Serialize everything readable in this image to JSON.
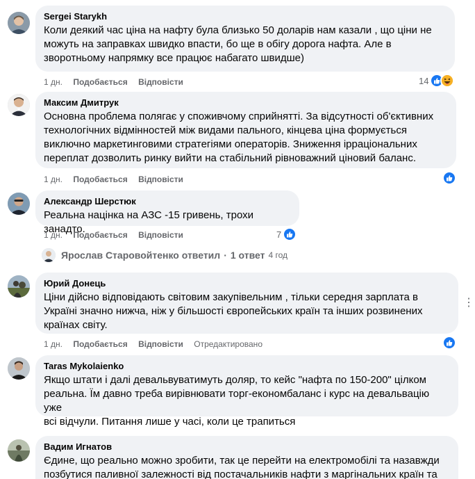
{
  "comments": [
    {
      "author": "Sergei Starykh",
      "lines": [
        "Коли деякий час ціна на нафту була близько 50 доларів нам казали , що ціни не",
        "можуть на заправках швидко впасти, бо ще в обігу дорога нафта. Але в",
        "зворотньому напрямку все працює набагато швидше)"
      ],
      "time": "1 дн.",
      "like": "Подобається",
      "reply": "Відповісти",
      "reaction_count": "14"
    },
    {
      "author": "Максим Дмитрук",
      "lines": [
        "Основна проблема полягає у споживчому сприйнятті. За відсутності об'єктивних",
        "технологічних відмінностей між видами пального, кінцева ціна формується",
        "виключно маркетинговими стратегіями операторів. Зниження ірраціональних",
        "переплат дозволить ринку вийти на стабільний рівноважний ціновий баланс."
      ],
      "time": "1 дн.",
      "like": "Подобається",
      "reply": "Відповісти",
      "reaction_count": ""
    },
    {
      "author": "Александр Шерстюк",
      "lines": [
        "Реальна націнка на АЗС -15 гривень, трохи занадто."
      ],
      "time": "1 дн.",
      "like": "Подобається",
      "reply": "Відповісти",
      "reaction_count": "7"
    },
    {
      "author": "Юрий Донець",
      "lines": [
        "Ціни дійсно відповідають світовим закупівельним , тільки середня зарплата в",
        "Україні значно нижча, ніж у більшості європейських країн та інших розвинених",
        "країнах світу."
      ],
      "time": "1 дн.",
      "like": "Подобається",
      "reply": "Відповісти",
      "edited": "Отредактировано",
      "reaction_count": ""
    },
    {
      "author": "Taras Mykolaienko",
      "lines": [
        "Якщо штати і далі девальвуватимуть доляр, то кейс \"нафта по 150-200\" цілком",
        "реальна. Їм давно треба вирівнювати торг-економбаланс і курс на девальвацію уже",
        "всі відчули. Питання лише у часі, коли це трапиться"
      ]
    },
    {
      "author": "Вадим Игнатов",
      "lines": [
        "Єдине, що реально можно зробити, так це перейти на електромобілі та назавжди",
        "позбутися паливної залежності від постачальників нафти з маргінальних країн та"
      ]
    }
  ],
  "replies": {
    "text": "Ярослав Старовойтенко ответил",
    "separator": "·",
    "count": "1 ответ",
    "time": "4 год"
  },
  "more_options": "⋮",
  "colors": {
    "bubble": "#f0f2f5",
    "secondary_text": "#65676b",
    "like_blue": "#1877f2",
    "haha_yellow": "#f7b125"
  }
}
